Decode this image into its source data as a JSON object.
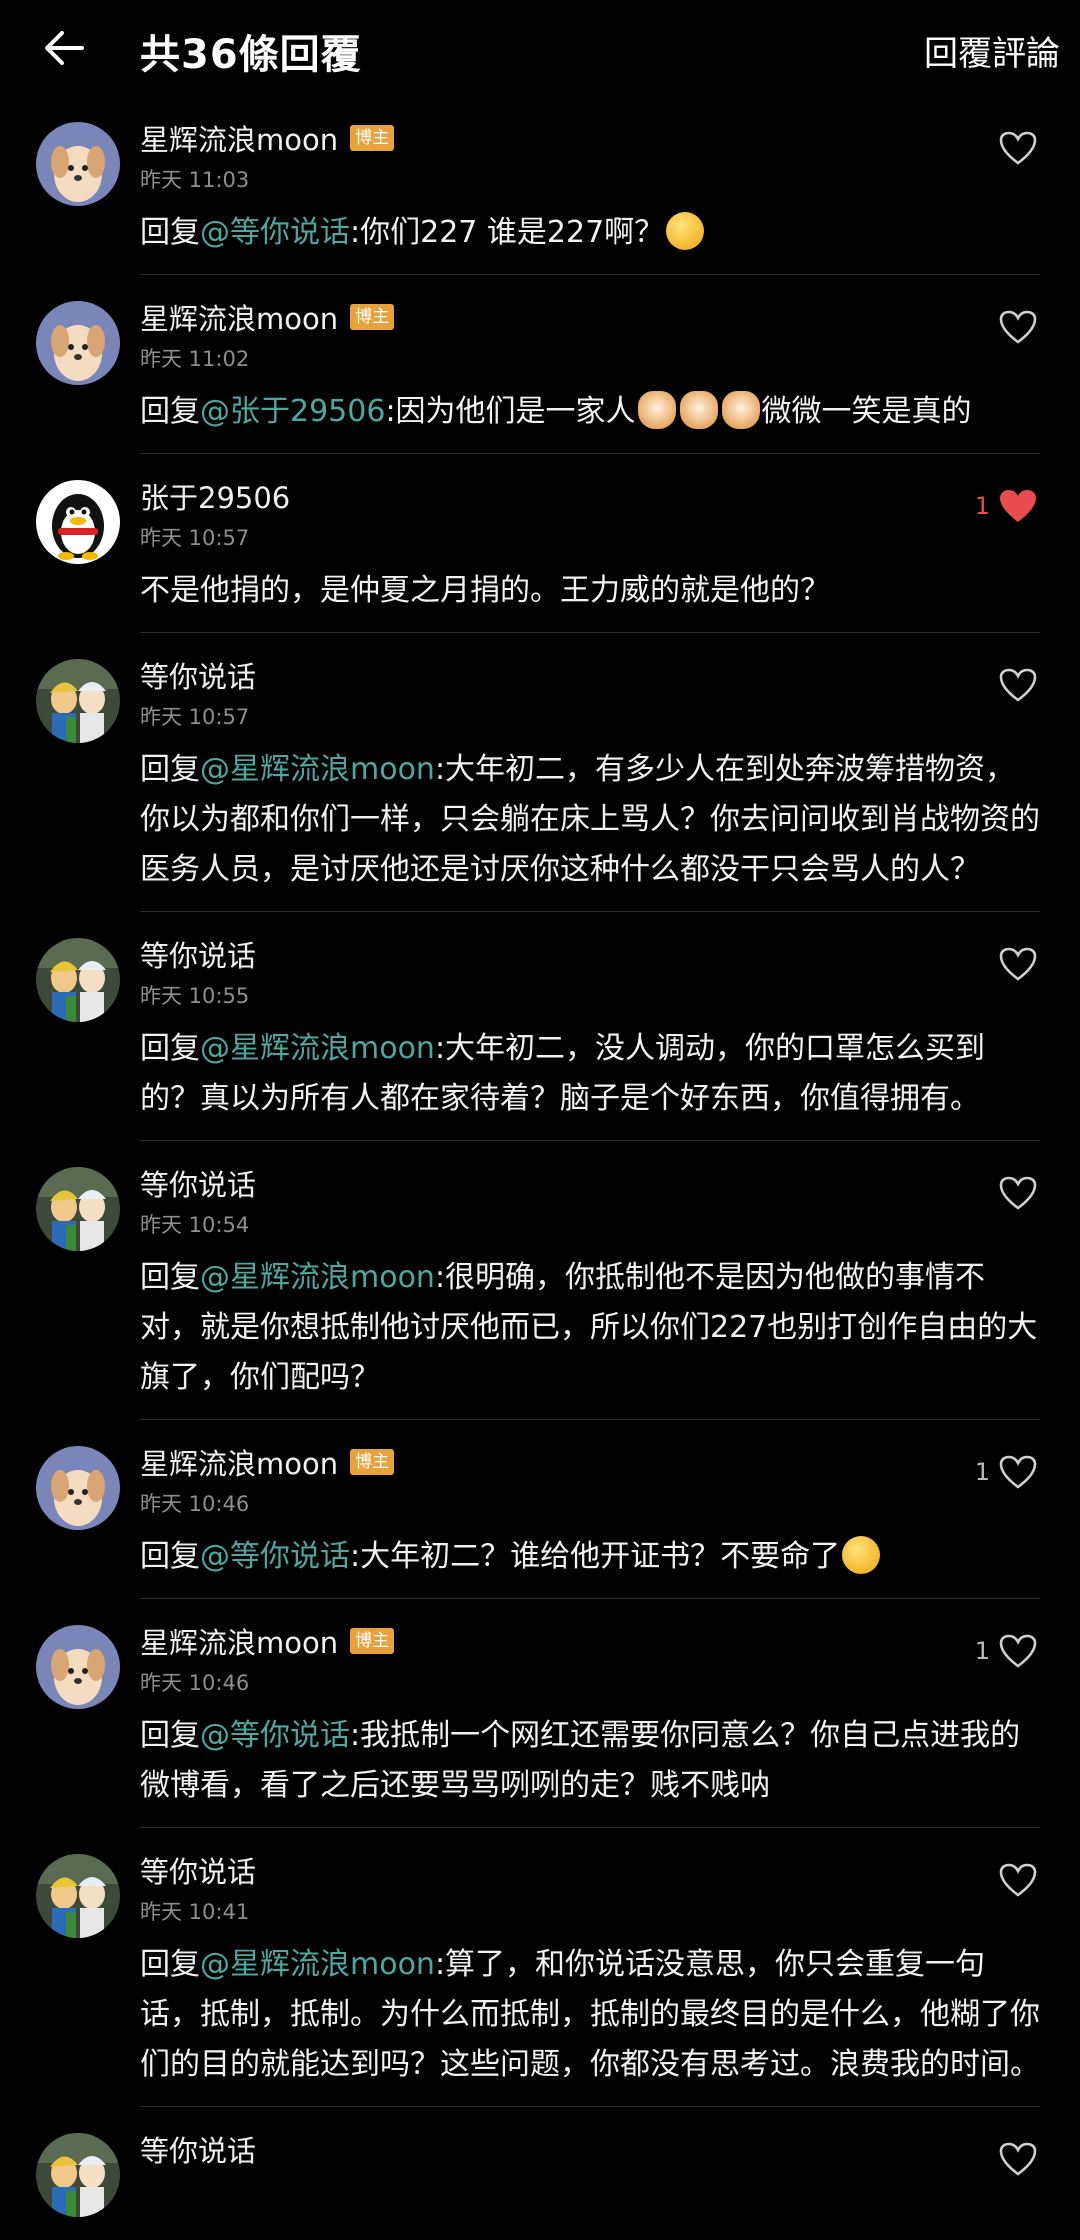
{
  "header": {
    "title": "共36條回覆",
    "reply_action": "回覆評論"
  },
  "comments": [
    {
      "author": "星辉流浪moon",
      "badge": "博主",
      "time": "昨天 11:03",
      "reply_prefix": "回复",
      "mention": "@等你说话",
      "text": ":你们227   谁是227啊？",
      "emoji": "smile-tongue-emoji",
      "likes": "",
      "liked": false,
      "avatar": "dog"
    },
    {
      "author": "星辉流浪moon",
      "badge": "博主",
      "time": "昨天 11:02",
      "reply_prefix": "回复",
      "mention": "@张于29506",
      "text": ":因为他们是一家人",
      "text_after": "微微一笑是真的",
      "emoji": "cat-emoji",
      "likes": "",
      "liked": false,
      "avatar": "dog"
    },
    {
      "author": "张于29506",
      "badge": "",
      "time": "昨天 10:57",
      "reply_prefix": "",
      "mention": "",
      "text": "不是他捐的，是仲夏之月捐的。王力威的就是他的？",
      "likes": "1",
      "liked": true,
      "avatar": "penguin"
    },
    {
      "author": "等你说话",
      "badge": "",
      "time": "昨天 10:57",
      "reply_prefix": "回复",
      "mention": "@星辉流浪moon",
      "text": ":大年初二，有多少人在到处奔波筹措物资，你以为都和你们一样，只会躺在床上骂人？你去问问收到肖战物资的医务人员，是讨厌他还是讨厌你这种什么都没干只会骂人的人？",
      "likes": "",
      "liked": false,
      "avatar": "anime"
    },
    {
      "author": "等你说话",
      "badge": "",
      "time": "昨天 10:55",
      "reply_prefix": "回复",
      "mention": "@星辉流浪moon",
      "text": ":大年初二，没人调动，你的口罩怎么买到的？真以为所有人都在家待着？脑子是个好东西，你值得拥有。",
      "likes": "",
      "liked": false,
      "avatar": "anime"
    },
    {
      "author": "等你说话",
      "badge": "",
      "time": "昨天 10:54",
      "reply_prefix": "回复",
      "mention": "@星辉流浪moon",
      "text": ":很明确，你抵制他不是因为他做的事情不对，就是你想抵制他讨厌他而已，所以你们227也别打创作自由的大旗了，你们配吗？",
      "likes": "",
      "liked": false,
      "avatar": "anime"
    },
    {
      "author": "星辉流浪moon",
      "badge": "博主",
      "time": "昨天 10:46",
      "reply_prefix": "回复",
      "mention": "@等你说话",
      "text": ":大年初二？谁给他开证书？不要命了",
      "emoji": "smile-emoji",
      "likes": "1",
      "liked": false,
      "avatar": "dog"
    },
    {
      "author": "星辉流浪moon",
      "badge": "博主",
      "time": "昨天 10:46",
      "reply_prefix": "回复",
      "mention": "@等你说话",
      "text": ":我抵制一个网红还需要你同意么？你自己点进我的微博看，看了之后还要骂骂咧咧的走？贱不贱呐",
      "likes": "1",
      "liked": false,
      "avatar": "dog"
    },
    {
      "author": "等你说话",
      "badge": "",
      "time": "昨天 10:41",
      "reply_prefix": "回复",
      "mention": "@星辉流浪moon",
      "text": ":算了，和你说话没意思，你只会重复一句话，抵制，抵制。为什么而抵制，抵制的最终目的是什么，他糊了你们的目的就能达到吗？这些问题，你都没有思考过。浪费我的时间。",
      "likes": "",
      "liked": false,
      "avatar": "anime"
    },
    {
      "author": "等你说话",
      "badge": "",
      "time": "",
      "reply_prefix": "",
      "mention": "",
      "text": "",
      "likes": "",
      "liked": false,
      "avatar": "anime"
    }
  ],
  "colors": {
    "mention": "#4aa8a0",
    "badge": "#e8a23b",
    "liked": "#e84c4c"
  }
}
